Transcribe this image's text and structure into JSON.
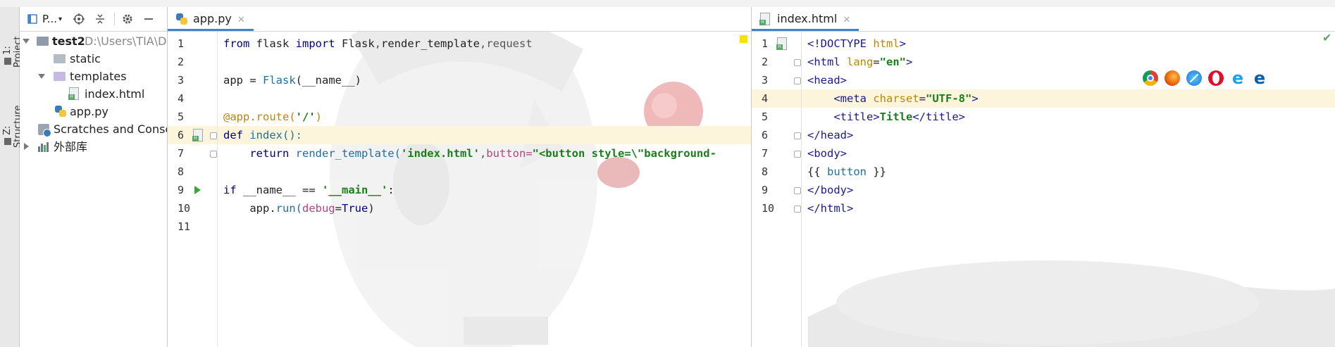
{
  "sidebar_tabs": [
    "1: Project",
    "Z: Structure"
  ],
  "project_panel": {
    "title": "P...",
    "tree": [
      {
        "label": "test2",
        "hint": "D:\\Users\\TIA\\Do",
        "type": "project-folder"
      },
      {
        "label": "static",
        "type": "folder"
      },
      {
        "label": "templates",
        "type": "folder"
      },
      {
        "label": "index.html",
        "type": "html-file"
      },
      {
        "label": "app.py",
        "type": "python-file"
      },
      {
        "label": "Scratches and Console",
        "type": "scratches"
      },
      {
        "label": "外部库",
        "type": "library"
      }
    ]
  },
  "editor_left": {
    "tab": "app.py",
    "line_numbers": [
      "1",
      "2",
      "3",
      "4",
      "5",
      "6",
      "7",
      "8",
      "9",
      "10",
      "11"
    ],
    "lines": [
      [
        {
          "t": "from",
          "c": "kw"
        },
        {
          "t": " flask ",
          "c": ""
        },
        {
          "t": "import",
          "c": "kw"
        },
        {
          "t": " Flask",
          "c": ""
        },
        {
          "t": ",",
          "c": "muted"
        },
        {
          "t": "render_template",
          "c": ""
        },
        {
          "t": ",",
          "c": "muted"
        },
        {
          "t": "request",
          "c": "muted"
        }
      ],
      [],
      [
        {
          "t": "app = ",
          "c": ""
        },
        {
          "t": "Flask",
          "c": "fn"
        },
        {
          "t": "(__name__)",
          "c": ""
        }
      ],
      [],
      [
        {
          "t": "@app.route(",
          "c": "dec"
        },
        {
          "t": "'/'",
          "c": "str"
        },
        {
          "t": ")",
          "c": "dec"
        }
      ],
      [
        {
          "t": "def",
          "c": "kw"
        },
        {
          "t": " index():",
          "c": "fn"
        }
      ],
      [
        {
          "t": "    return ",
          "c": "kw"
        },
        {
          "t": "render_template(",
          "c": "fn"
        },
        {
          "t": "'index.html'",
          "c": "str"
        },
        {
          "t": ",",
          "c": "muted"
        },
        {
          "t": "button=",
          "c": "prm"
        },
        {
          "t": "\"<button style=\\\"background-",
          "c": "str"
        }
      ],
      [],
      [
        {
          "t": "if",
          "c": "kw"
        },
        {
          "t": " __name__ == ",
          "c": ""
        },
        {
          "t": "'__main__'",
          "c": "str"
        },
        {
          "t": ":",
          "c": ""
        }
      ],
      [
        {
          "t": "    app.",
          "c": ""
        },
        {
          "t": "run(",
          "c": "fn"
        },
        {
          "t": "debug",
          "c": "prm"
        },
        {
          "t": "=",
          "c": ""
        },
        {
          "t": "True",
          "c": "kw"
        },
        {
          "t": ")",
          "c": ""
        }
      ],
      []
    ],
    "highlighted_line": 6
  },
  "editor_right": {
    "tab": "index.html",
    "line_numbers": [
      "1",
      "2",
      "3",
      "4",
      "5",
      "6",
      "7",
      "8",
      "9",
      "10"
    ],
    "lines": [
      [
        {
          "t": "<!DOCTYPE ",
          "c": "tag"
        },
        {
          "t": "html",
          "c": "attr"
        },
        {
          "t": ">",
          "c": "tag"
        }
      ],
      [
        {
          "t": "<html ",
          "c": "tag"
        },
        {
          "t": "lang",
          "c": "attr"
        },
        {
          "t": "=",
          "c": ""
        },
        {
          "t": "\"en\"",
          "c": "aval"
        },
        {
          "t": ">",
          "c": "tag"
        }
      ],
      [
        {
          "t": "<head>",
          "c": "tag"
        }
      ],
      [
        {
          "t": "    <meta ",
          "c": "tag"
        },
        {
          "t": "charset",
          "c": "attr"
        },
        {
          "t": "=",
          "c": ""
        },
        {
          "t": "\"UTF-8\"",
          "c": "aval"
        },
        {
          "t": ">",
          "c": "tag"
        }
      ],
      [
        {
          "t": "    <title>",
          "c": "tag"
        },
        {
          "t": "Title",
          "c": "aval"
        },
        {
          "t": "</title>",
          "c": "tag"
        }
      ],
      [
        {
          "t": "</head>",
          "c": "tag"
        }
      ],
      [
        {
          "t": "<body>",
          "c": "tag"
        }
      ],
      [
        {
          "t": "{{ ",
          "c": ""
        },
        {
          "t": "button",
          "c": "fn"
        },
        {
          "t": " }}",
          "c": ""
        }
      ],
      [
        {
          "t": "</body>",
          "c": "tag"
        }
      ],
      [
        {
          "t": "</html>",
          "c": "tag"
        }
      ]
    ],
    "highlighted_line": 4
  },
  "browser_icons": [
    "chrome-icon",
    "firefox-icon",
    "safari-icon",
    "opera-icon",
    "ie-icon",
    "edge-icon"
  ],
  "colors": {
    "accent": "#4083c9",
    "current_line": "#fcf5dc",
    "keyword": "#000080",
    "string": "#1a7e1a",
    "run": "#3ea63e"
  }
}
